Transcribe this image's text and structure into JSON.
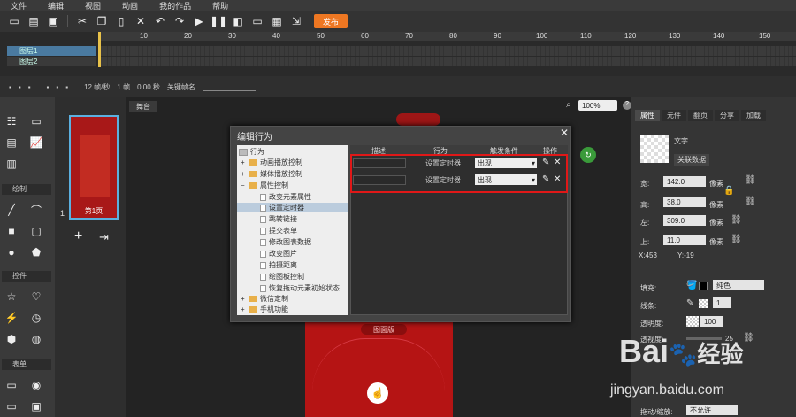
{
  "menu": [
    "文件",
    "编辑",
    "视图",
    "动画",
    "我的作品",
    "帮助"
  ],
  "toolbar": {
    "publish_label": "发布"
  },
  "timeline": {
    "ruler_ticks": [
      "10",
      "20",
      "30",
      "40",
      "50",
      "60",
      "70",
      "80",
      "90",
      "100",
      "110",
      "120",
      "130",
      "140",
      "150"
    ],
    "layers": [
      "图层1",
      "图层2"
    ],
    "status": {
      "fps": "12 帧/秒",
      "frame": "1 帧",
      "time": "0.00 秒",
      "keyframe_label": "关键帧名"
    }
  },
  "left_panel": {
    "sections": [
      "绘制",
      "控件",
      "表单"
    ]
  },
  "pages": {
    "page_number": "1",
    "thumb_label": "第1页"
  },
  "stage": {
    "tab_label": "舞台",
    "zoom": "100%",
    "phone_button": "图面版"
  },
  "dialog": {
    "title": "编辑行为",
    "tree": {
      "root": "行为",
      "nodes": [
        {
          "label": "动画播放控制",
          "type": "folder",
          "level": 1,
          "expander": "+"
        },
        {
          "label": "媒体播放控制",
          "type": "folder",
          "level": 1,
          "expander": "+"
        },
        {
          "label": "属性控制",
          "type": "folder",
          "level": 1,
          "expander": "−"
        },
        {
          "label": "改变元素属性",
          "type": "item",
          "level": 2
        },
        {
          "label": "设置定时器",
          "type": "item",
          "level": 2,
          "selected": true
        },
        {
          "label": "跳转链接",
          "type": "item",
          "level": 2
        },
        {
          "label": "提交表单",
          "type": "item",
          "level": 2
        },
        {
          "label": "修改图表数据",
          "type": "item",
          "level": 2
        },
        {
          "label": "改变图片",
          "type": "item",
          "level": 2
        },
        {
          "label": "拍摄距离",
          "type": "item",
          "level": 2
        },
        {
          "label": "绘图板控制",
          "type": "item",
          "level": 2
        },
        {
          "label": "恢复拖动元素初始状态",
          "type": "item",
          "level": 2
        },
        {
          "label": "微信定制",
          "type": "folder",
          "level": 1,
          "expander": "+"
        },
        {
          "label": "手机功能",
          "type": "folder",
          "level": 1,
          "expander": "+"
        }
      ]
    },
    "columns": [
      "描述",
      "行为",
      "触发条件",
      "操作"
    ],
    "rows": [
      {
        "desc": "",
        "action": "设置定时器",
        "condition": "出现"
      },
      {
        "desc": "",
        "action": "设置定时器",
        "condition": "出现"
      }
    ]
  },
  "properties": {
    "tabs": [
      "属性",
      "元件",
      "翻页",
      "分享",
      "加载"
    ],
    "element_type": "文字",
    "link_data_label": "关联数据",
    "width_label": "宽:",
    "width": "142.0",
    "height_label": "高:",
    "height": "38.0",
    "left_label": "左:",
    "left": "309.0",
    "top_label": "上:",
    "top": "11.0",
    "unit": "像素",
    "coords": {
      "x": "X:453",
      "y": "Y:-19"
    },
    "fill_label": "填充:",
    "fill_type": "纯色",
    "stroke_label": "线条:",
    "stroke_width": "1",
    "opacity_label": "透明度:",
    "opacity": "100",
    "blur_label": "透视度:",
    "blur": "25",
    "drag_label": "拖动/缩放:",
    "drag_value": "不允许"
  },
  "watermark": {
    "brand": "Bai",
    "brand2": "经验",
    "url": "jingyan.baidu.com"
  }
}
